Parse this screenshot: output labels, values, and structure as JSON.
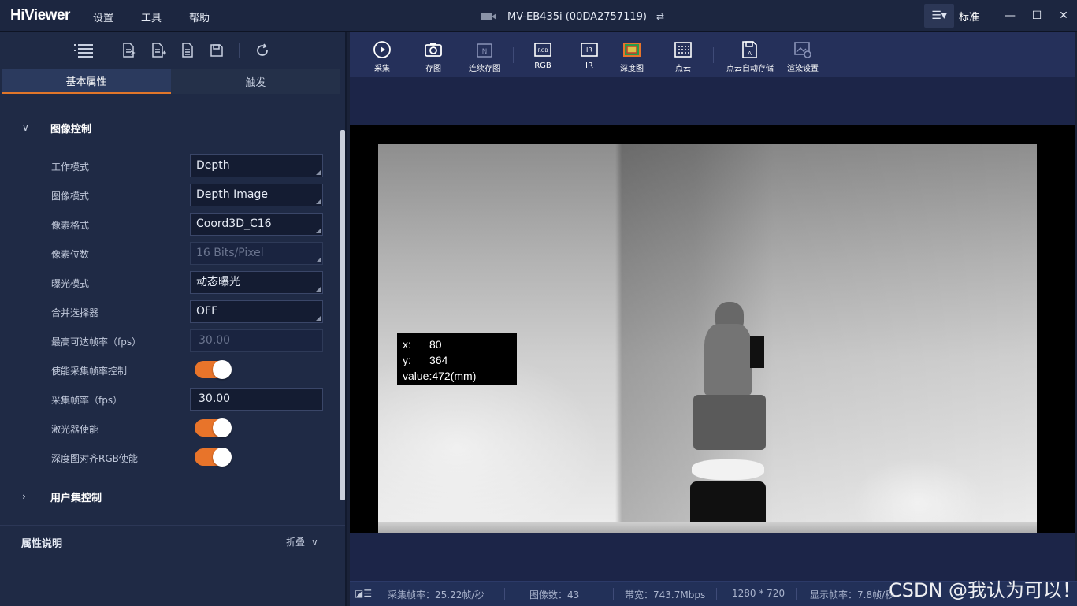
{
  "app": {
    "logo": "HiViewer",
    "menu": [
      "设置",
      "工具",
      "帮助"
    ],
    "camera_title": "MV-EB435i (00DA2757119)",
    "mode_label": "标准"
  },
  "left_panel": {
    "tabs": [
      "基本属性",
      "触发"
    ],
    "sections": {
      "image_control": "图像控制",
      "user_set_control": "用户集控制"
    },
    "properties": [
      {
        "label": "工作模式",
        "value": "Depth",
        "type": "select"
      },
      {
        "label": "图像模式",
        "value": "Depth Image",
        "type": "select"
      },
      {
        "label": "像素格式",
        "value": "Coord3D_C16",
        "type": "select"
      },
      {
        "label": "像素位数",
        "value": "16 Bits/Pixel",
        "type": "select-disabled"
      },
      {
        "label": "曝光模式",
        "value": "动态曝光",
        "type": "select"
      },
      {
        "label": "合并选择器",
        "value": "OFF",
        "type": "select"
      },
      {
        "label": "最高可达帧率（fps）",
        "value": "30.00",
        "type": "input-disabled"
      },
      {
        "label": "使能采集帧率控制",
        "value": "on",
        "type": "toggle"
      },
      {
        "label": "采集帧率（fps）",
        "value": "30.00",
        "type": "input"
      },
      {
        "label": "激光器使能",
        "value": "on",
        "type": "toggle"
      },
      {
        "label": "深度图对齐RGB使能",
        "value": "on",
        "type": "toggle"
      }
    ],
    "description": {
      "title": "属性说明",
      "fold_label": "折叠"
    }
  },
  "toolbar": {
    "buttons": [
      "采集",
      "存图",
      "连续存图",
      "RGB",
      "IR",
      "深度图",
      "点云",
      "点云自动存储",
      "渲染设置"
    ]
  },
  "viewer": {
    "tooltip": {
      "x_label": "x:",
      "x": "80",
      "y_label": "y:",
      "y": "364",
      "value": "value:472(mm)"
    }
  },
  "status": {
    "capture_fps": "采集帧率：25.22帧/秒",
    "image_count": "图像数：43",
    "bandwidth": "带宽：743.7Mbps",
    "resolution": "1280 * 720",
    "display_fps": "显示帧率：7.8帧/秒"
  },
  "watermark": "CSDN @我认为可以！",
  "colors": {
    "accent": "#e8742a",
    "bg": "#1a2238",
    "panel": "#1f2a45"
  }
}
